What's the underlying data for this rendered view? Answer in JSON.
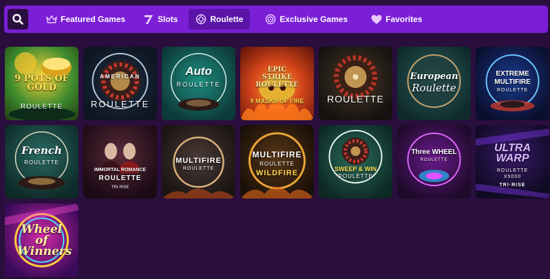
{
  "nav": {
    "tabs": [
      {
        "label": "Featured Games",
        "icon": "crown-icon"
      },
      {
        "label": "Slots",
        "icon": "seven-icon"
      },
      {
        "label": "Roulette",
        "icon": "roulette-wheel-icon",
        "active": true
      },
      {
        "label": "Exclusive Games",
        "icon": "target-icon"
      },
      {
        "label": "Favorites",
        "icon": "heart-icon"
      }
    ]
  },
  "colors": {
    "background": "#2a0e3d",
    "nav_bar": "#7a1fd6",
    "active_tab": "#5a14a8",
    "search_button": "#2a0e3d"
  },
  "games": [
    {
      "title": "9 POTS OF GOLD",
      "subtitle": "ROULETTE"
    },
    {
      "title": "AMERICAN",
      "subtitle": "ROULETTE"
    },
    {
      "title": "Auto",
      "subtitle": "ROULETTE"
    },
    {
      "title": "EPIC STRIKE ROULETTE",
      "subtitle": "9 MASKS OF FIRE"
    },
    {
      "title": "",
      "subtitle": "ROULETTE"
    },
    {
      "title": "European",
      "subtitle": "Roulette"
    },
    {
      "title": "EXTREME MULTIFIRE",
      "subtitle": "ROULETTE"
    },
    {
      "title": "French",
      "subtitle": "ROULETTE"
    },
    {
      "title": "IMMORTAL ROMANCE",
      "subtitle": "ROULETTE",
      "badge": "TRI·RISE"
    },
    {
      "title": "MULTIFIRE",
      "subtitle": "ROULETTE"
    },
    {
      "title": "MULTIFIRE",
      "subtitle": "ROULETTE",
      "badge": "WILDFIRE"
    },
    {
      "title": "SWEEP & WIN",
      "subtitle": "ROULETTE"
    },
    {
      "title": "Three WHEEL",
      "subtitle": "ROULETTE"
    },
    {
      "title": "ULTRA WARP",
      "subtitle": "ROULETTE X5000",
      "badge": "TRI·RISE"
    },
    {
      "title": "Wheel of Winners",
      "subtitle": ""
    }
  ]
}
